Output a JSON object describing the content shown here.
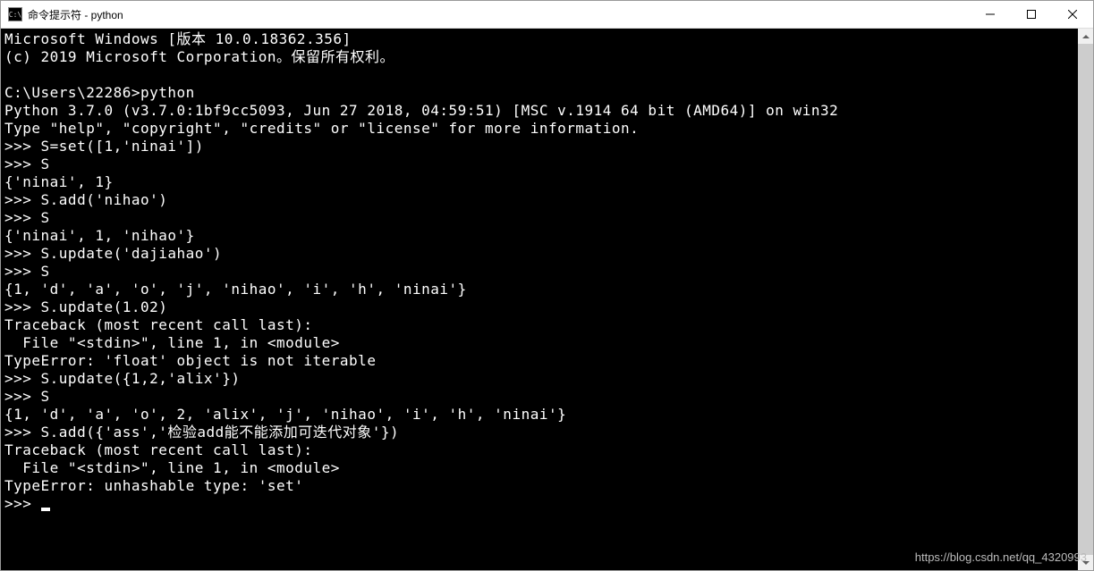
{
  "window": {
    "title": "命令提示符 - python",
    "icon_label": "C:\\"
  },
  "terminal": {
    "lines": [
      "Microsoft Windows [版本 10.0.18362.356]",
      "(c) 2019 Microsoft Corporation。保留所有权利。",
      "",
      "C:\\Users\\22286>python",
      "Python 3.7.0 (v3.7.0:1bf9cc5093, Jun 27 2018, 04:59:51) [MSC v.1914 64 bit (AMD64)] on win32",
      "Type \"help\", \"copyright\", \"credits\" or \"license\" for more information.",
      ">>> S=set([1,'ninai'])",
      ">>> S",
      "{'ninai', 1}",
      ">>> S.add('nihao')",
      ">>> S",
      "{'ninai', 1, 'nihao'}",
      ">>> S.update('dajiahao')",
      ">>> S",
      "{1, 'd', 'a', 'o', 'j', 'nihao', 'i', 'h', 'ninai'}",
      ">>> S.update(1.02)",
      "Traceback (most recent call last):",
      "  File \"<stdin>\", line 1, in <module>",
      "TypeError: 'float' object is not iterable",
      ">>> S.update({1,2,'alix'})",
      ">>> S",
      "{1, 'd', 'a', 'o', 2, 'alix', 'j', 'nihao', 'i', 'h', 'ninai'}",
      ">>> S.add({'ass','检验add能不能添加可迭代对象'})",
      "Traceback (most recent call last):",
      "  File \"<stdin>\", line 1, in <module>",
      "TypeError: unhashable type: 'set'",
      ">>> "
    ]
  },
  "watermark": "https://blog.csdn.net/qq_4320993"
}
